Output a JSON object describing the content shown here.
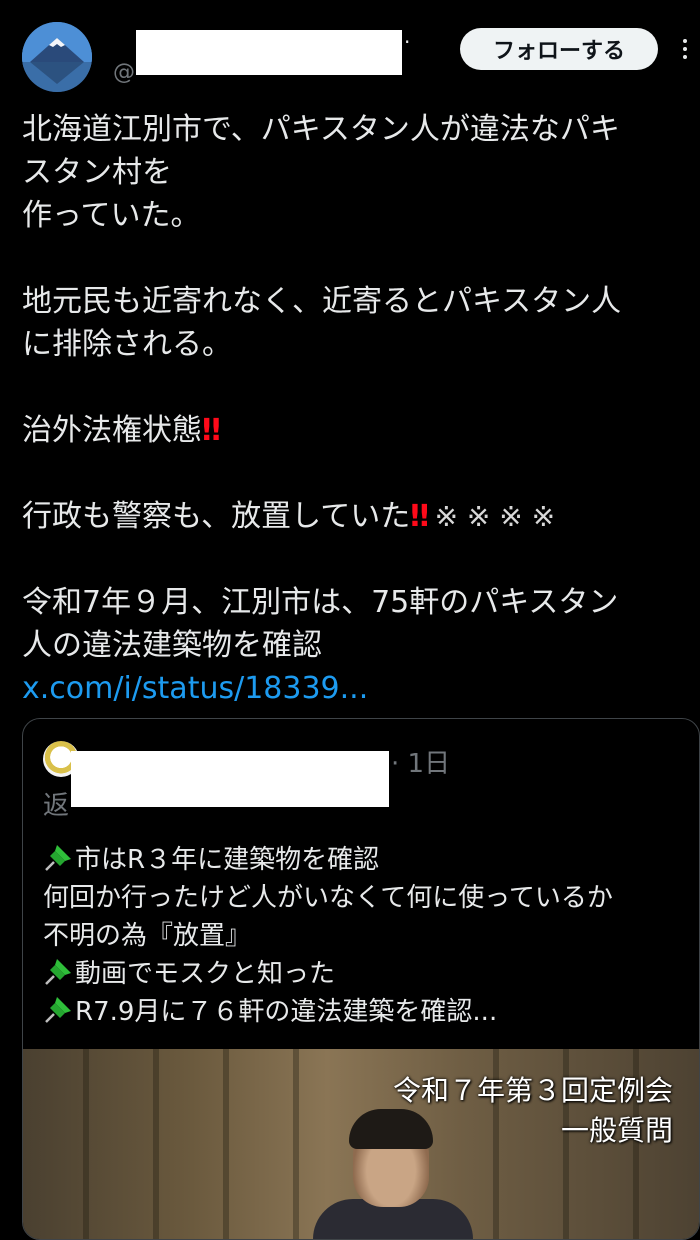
{
  "header": {
    "handle": "@",
    "follow_label": "フォローする"
  },
  "post": {
    "line1": "北海道江別市で、パキスタン人が違法なパキ",
    "line2": "スタン村を",
    "line3": "作っていた。",
    "line4": "地元民も近寄れなく、近寄るとパキスタン人",
    "line5": "に排除される。",
    "line6": "治外法権状態",
    "line6_emoji": "‼",
    "line7": "行政も警察も、放置していた",
    "line7_emoji": "‼",
    "line7_marks": "※ ※ ※ ※",
    "line8": "令和7年９月、江別市は、75軒のパキスタン",
    "line9": "人の違法建築物を確認",
    "link": "x.com/i/status/18339..."
  },
  "quote": {
    "time": "· 1日",
    "reply_prefix": "返",
    "lines": [
      "市はR３年に建築物を確認",
      "何回か行ったけど人がいなくて何に使っているか",
      "不明の為『放置』",
      "動画でモスクと知った",
      "R7.9月に７６軒の違法建築を確認..."
    ],
    "video_caption_1": "令和７年第３回定例会",
    "video_caption_2": "一般質問"
  },
  "icons": {
    "avatar": "mount-fuji-avatar",
    "pin": "pushpin-icon",
    "more": "more-options-icon"
  },
  "colors": {
    "link": "#1d9bf0",
    "emphasis": "#ff0a1a",
    "pin": "#2fbf3a"
  }
}
